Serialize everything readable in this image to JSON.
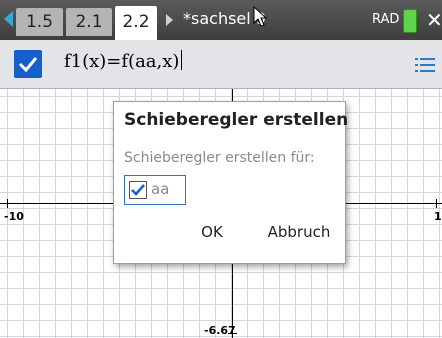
{
  "tabs": [
    {
      "label": "1.5",
      "active": false
    },
    {
      "label": "2.1",
      "active": false
    },
    {
      "label": "2.2",
      "active": true
    }
  ],
  "document_title": "*sachsel 9",
  "mode": "RAD",
  "entry": {
    "formula_prefix": "f1",
    "formula": "f1(x)=f(aa,x)"
  },
  "graph": {
    "x_min_label": "-10",
    "x_max_label": "1",
    "y_min_label": "-6.67",
    "y_right_partial": "1"
  },
  "dialog": {
    "title": "Schieberegler erstellen",
    "subtitle": "Schieberegler erstellen für:",
    "variable": "aa",
    "variable_checked": true,
    "ok_label": "OK",
    "cancel_label": "Abbruch"
  },
  "colors": {
    "accent": "#1460c8",
    "topbar": "#4a4a4a",
    "entry_bg": "#e2e4e8",
    "grid": "#cfd8e0"
  }
}
